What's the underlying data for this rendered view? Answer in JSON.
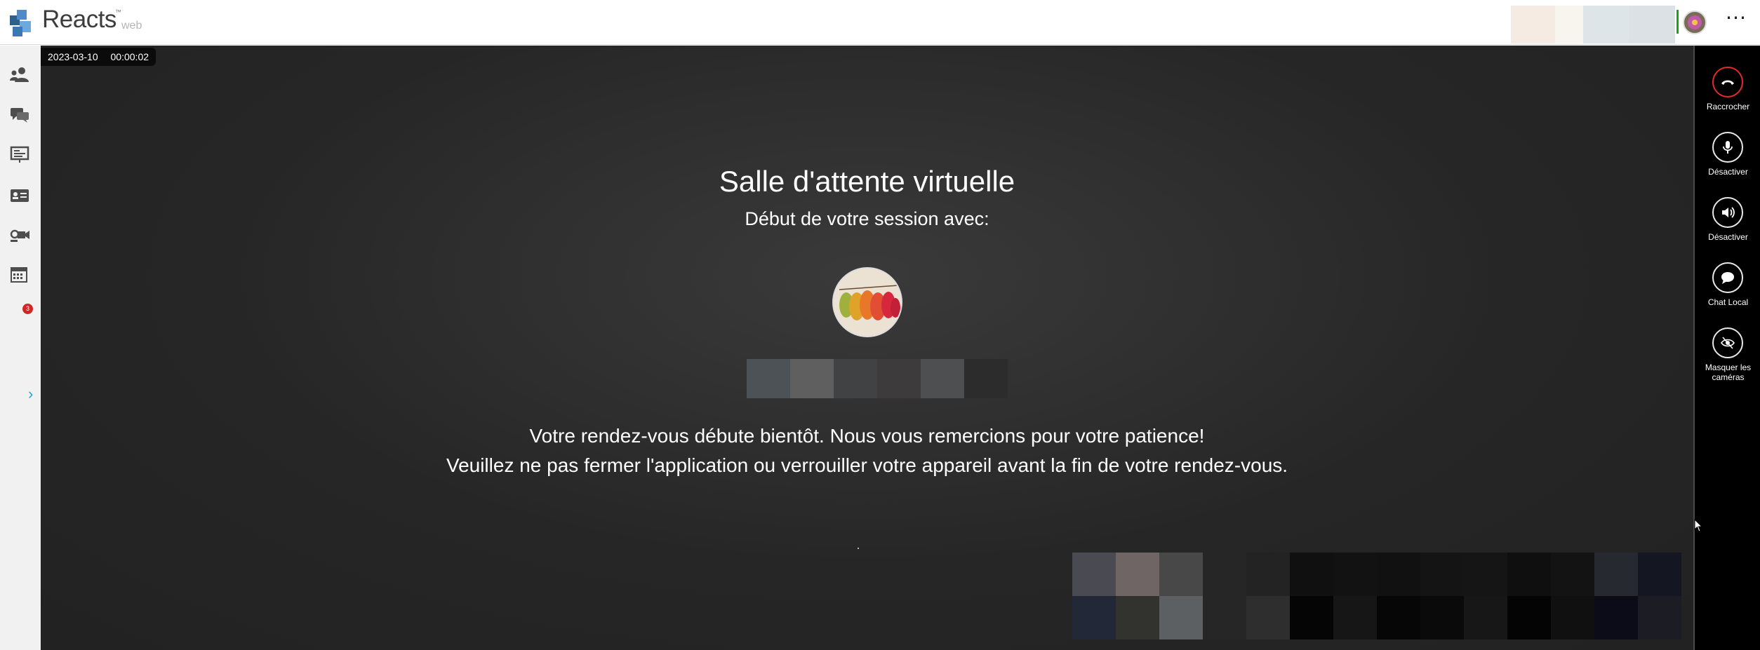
{
  "app": {
    "brand_name": "Reacts",
    "brand_trademark": "™",
    "brand_subtitle": "web"
  },
  "header": {
    "more_icon_glyph": "⋯",
    "presence_color": "#1aa31a"
  },
  "sidebar": {
    "items": [
      {
        "icon": "contacts-icon"
      },
      {
        "icon": "chat-icon"
      },
      {
        "icon": "presentation-icon"
      },
      {
        "icon": "id-card-icon"
      },
      {
        "icon": "video-camera-icon"
      },
      {
        "icon": "calendar-icon",
        "badge": "3"
      }
    ],
    "expand_glyph": "›"
  },
  "session": {
    "date": "2023-03-10",
    "elapsed": "00:00:02",
    "title": "Salle d'attente virtuelle",
    "subtitle": "Début de votre session avec:",
    "message_line1": "Votre rendez-vous débute bientôt. Nous vous remercions pour votre patience!",
    "message_line2": "Veuillez ne pas fermer l'application ou verrouiller votre appareil avant la fin de votre rendez-vous."
  },
  "controls": {
    "hangup": "Raccrocher",
    "mute_mic": "Désactiver",
    "mute_speaker": "Désactiver",
    "local_chat": "Chat Local",
    "hide_cameras": "Masquer les caméras"
  },
  "colors": {
    "accent": "#23a4d8",
    "hangup": "#e52a2a",
    "badge": "#d42424",
    "background": "#262626"
  }
}
